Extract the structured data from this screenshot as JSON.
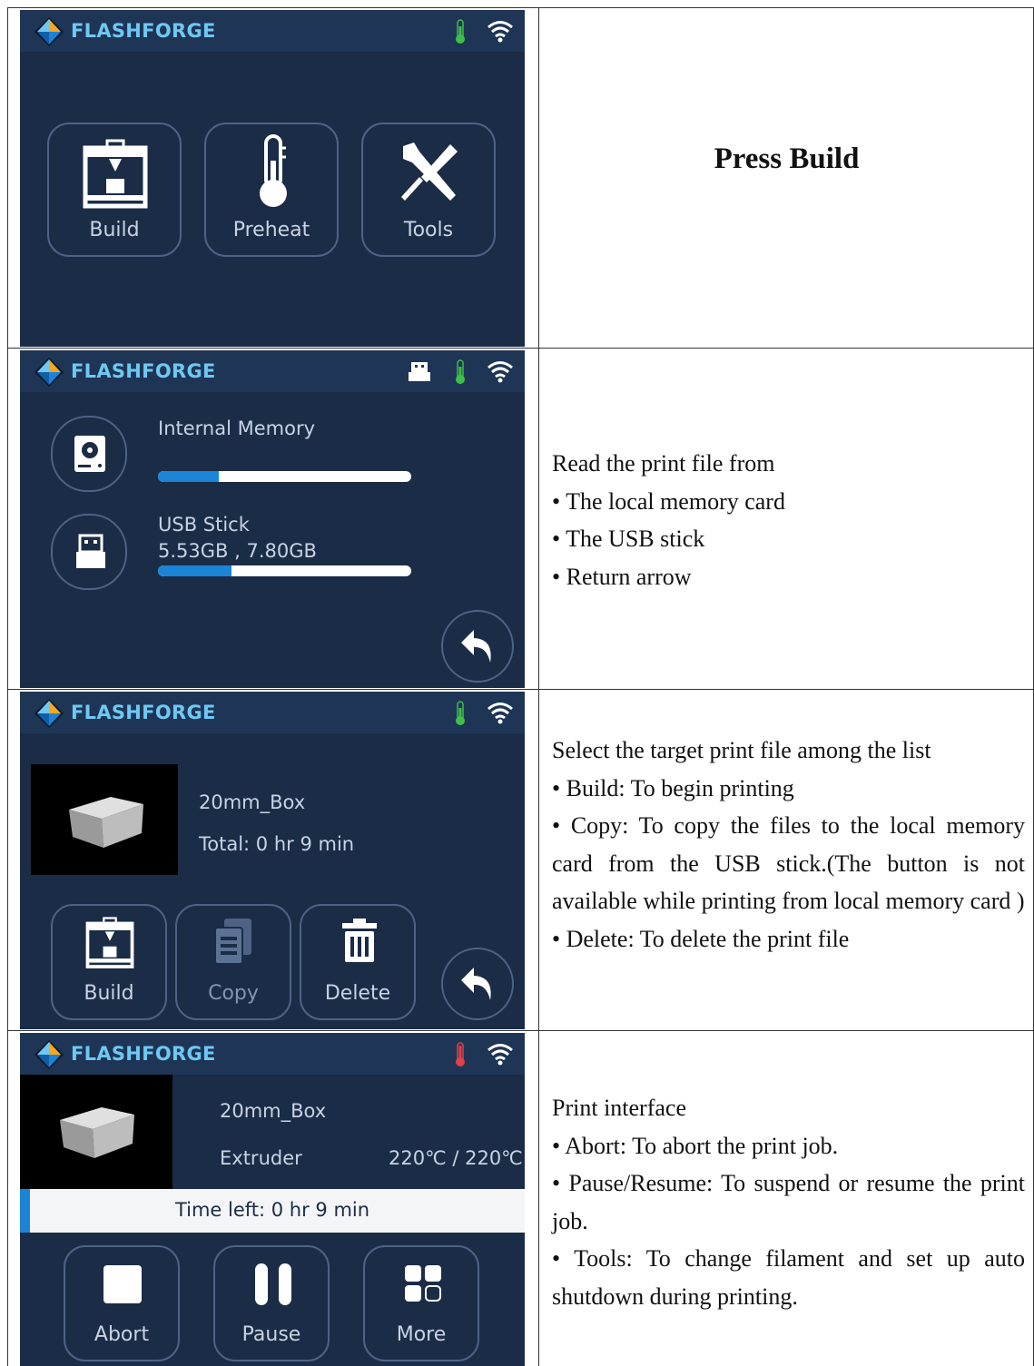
{
  "brand": "FLASHFORGE",
  "colors": {
    "screen_bg": "#1b2c47",
    "topbar": "#1e3556",
    "accent": "#6fc8f2",
    "progress": "#1c84d6",
    "temp_ok": "#3fbf4a",
    "temp_hot": "#e0404a"
  },
  "row1": {
    "tiles": [
      {
        "label": "Build",
        "icon": "printer-icon"
      },
      {
        "label": "Preheat",
        "icon": "thermometer-icon"
      },
      {
        "label": "Tools",
        "icon": "tools-icon"
      }
    ],
    "caption": "Press Build"
  },
  "row2": {
    "internal_label": "Internal Memory",
    "internal_usage": 0.24,
    "usb_label": "USB Stick",
    "usb_size": "5.53GB , 7.80GB",
    "usb_usage": 0.29,
    "desc_title": "Read the print file from",
    "bullets": [
      "• The local memory card",
      "• The USB stick",
      "• Return arrow"
    ]
  },
  "row3": {
    "file_name": "20mm_Box",
    "total": "Total: 0 hr 9 min",
    "buttons": [
      {
        "label": "Build",
        "icon": "printer-icon"
      },
      {
        "label": "Copy",
        "icon": "copy-icon"
      },
      {
        "label": "Delete",
        "icon": "trash-icon"
      }
    ],
    "desc_title": "Select the target print file among the list",
    "b1": "• Build: To begin printing",
    "b2": "• Copy: To copy the files to the local memory card from the USB stick.(The button is not available while printing from local memory card )",
    "b3": "• Delete: To delete the print file"
  },
  "row4": {
    "file_name": "20mm_Box",
    "extruder_label": "Extruder",
    "extruder_temp": "220℃ / 220℃",
    "time_left": "Time left: 0 hr 9 min",
    "print_progress": 0.02,
    "buttons": [
      {
        "label": "Abort",
        "icon": "stop-icon"
      },
      {
        "label": "Pause",
        "icon": "pause-icon"
      },
      {
        "label": "More",
        "icon": "more-grid-icon"
      }
    ],
    "desc_title": "Print interface",
    "b1": "• Abort: To abort the print job.",
    "b2": "• Pause/Resume: To suspend or resume the print job.",
    "b3": "• Tools: To change filament and set up auto shutdown during printing."
  }
}
